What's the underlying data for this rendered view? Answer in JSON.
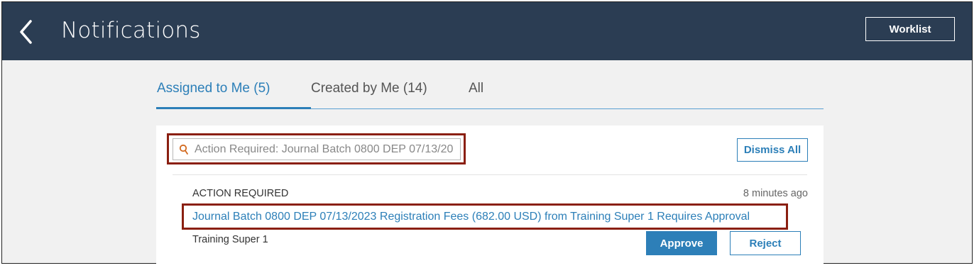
{
  "header": {
    "title": "Notifications",
    "worklist_label": "Worklist",
    "back_icon": "chevron-left-icon"
  },
  "tabs": [
    {
      "label": "Assigned to Me (5)",
      "active": true
    },
    {
      "label": "Created by Me (14)",
      "active": false
    },
    {
      "label": "All",
      "active": false
    }
  ],
  "search": {
    "value": "Action Required: Journal Batch 0800 DEP 07/13/20",
    "icon": "search-icon"
  },
  "dismiss_all_label": "Dismiss All",
  "notification": {
    "type": "ACTION REQUIRED",
    "time": "8 minutes ago",
    "title": "Journal Batch 0800 DEP 07/13/2023 Registration Fees (682.00 USD) from Training Super 1 Requires Approval",
    "from": "Training Super 1",
    "approve_label": "Approve",
    "reject_label": "Reject"
  },
  "colors": {
    "header_bg": "#2b3d53",
    "accent": "#2c7fb8",
    "highlight": "#8a1f10"
  }
}
